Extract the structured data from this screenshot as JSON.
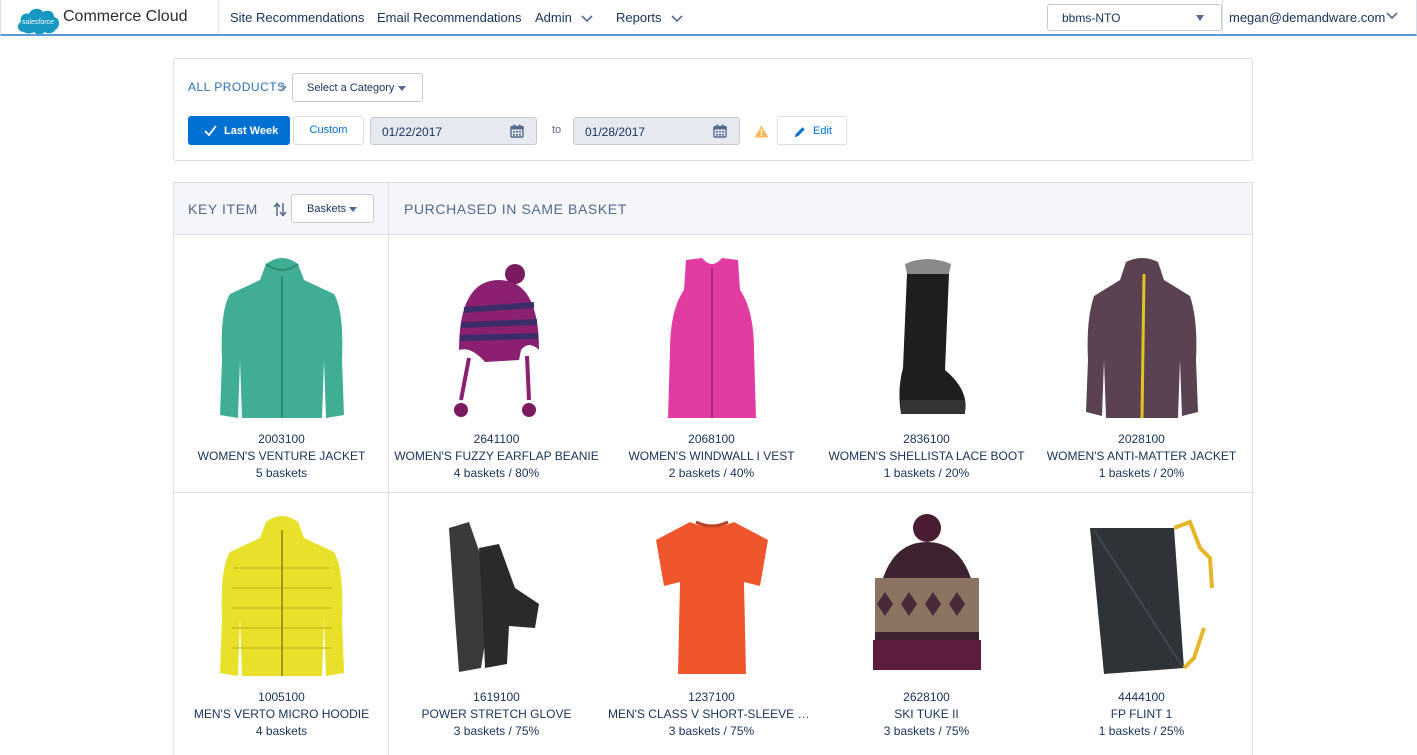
{
  "nav": {
    "logo_text": "salesforce",
    "brand": "Commerce Cloud",
    "items": [
      {
        "label": "Site Recommendations"
      },
      {
        "label": "Email Recommendations"
      },
      {
        "label": "Admin"
      },
      {
        "label": "Reports"
      }
    ],
    "site_select": "bbms-NTO",
    "user": "megan@demandware.com",
    "accent_color": "#5b9bd5"
  },
  "filters": {
    "breadcrumb_all": "ALL PRODUCTS",
    "breadcrumb_sep": ">",
    "category_select": "Select a Category",
    "last_week_label": "Last Week",
    "custom_label": "Custom",
    "date_from": "01/22/2017",
    "to_label": "to",
    "date_to": "01/28/2017",
    "edit_label": "Edit",
    "primary_color": "#0070d2",
    "warning_color": "#ffb75d"
  },
  "table": {
    "key_item_header": "KEY ITEM",
    "sort_select": "Baskets",
    "purchased_header": "PURCHASED IN SAME BASKET",
    "rows": [
      {
        "key": {
          "sku": "2003100",
          "name": "WOMEN'S VENTURE JACKET",
          "stat": "5 baskets",
          "icon": "teal-jacket"
        },
        "items": [
          {
            "sku": "2641100",
            "name": "WOMEN'S FUZZY EARFLAP BEANIE",
            "stat": "4 baskets / 80%",
            "icon": "striped-beanie"
          },
          {
            "sku": "2068100",
            "name": "WOMEN'S WINDWALL I VEST",
            "stat": "2 baskets / 40%",
            "icon": "pink-vest"
          },
          {
            "sku": "2836100",
            "name": "WOMEN'S SHELLISTA LACE BOOT",
            "stat": "1 baskets / 20%",
            "icon": "black-boot"
          },
          {
            "sku": "2028100",
            "name": "WOMEN'S ANTI-MATTER JACKET",
            "stat": "1 baskets / 20%",
            "icon": "purple-jacket"
          }
        ]
      },
      {
        "key": {
          "sku": "1005100",
          "name": "MEN'S VERTO MICRO HOODIE",
          "stat": "4 baskets",
          "icon": "yellow-hoodie"
        },
        "items": [
          {
            "sku": "1619100",
            "name": "POWER STRETCH GLOVE",
            "stat": "3 baskets / 75%",
            "icon": "black-gloves"
          },
          {
            "sku": "1237100",
            "name": "MEN'S CLASS V SHORT-SLEEVE W...",
            "stat": "3 baskets / 75%",
            "icon": "orange-tshirt"
          },
          {
            "sku": "2628100",
            "name": "SKI TUKE II",
            "stat": "3 baskets / 75%",
            "icon": "knit-tuke"
          },
          {
            "sku": "4444100",
            "name": "FP FLINT 1",
            "stat": "1 baskets / 25%",
            "icon": "footprint-tarp"
          }
        ]
      }
    ]
  }
}
